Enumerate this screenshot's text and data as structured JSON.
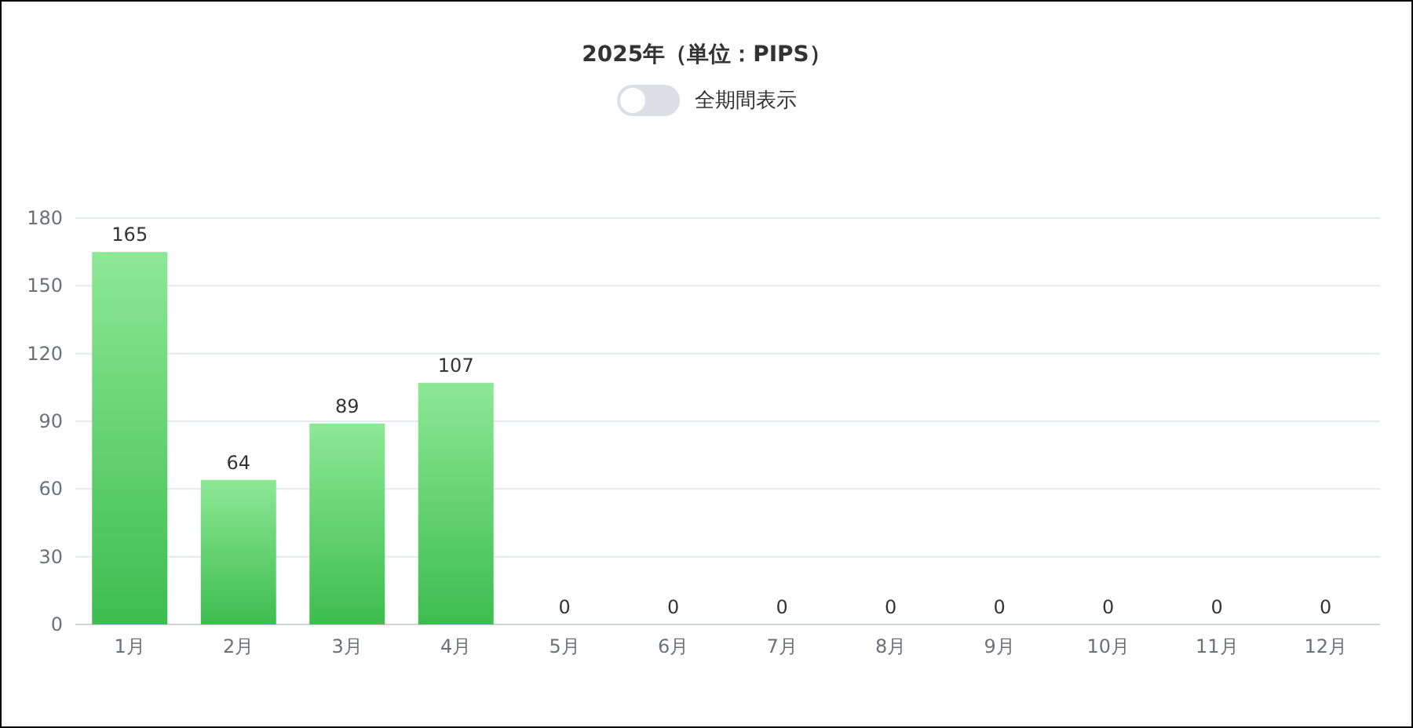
{
  "title": "2025年（単位：PIPS）",
  "toggle": {
    "label": "全期間表示",
    "on": false
  },
  "chart_data": {
    "type": "bar",
    "categories": [
      "1月",
      "2月",
      "3月",
      "4月",
      "5月",
      "6月",
      "7月",
      "8月",
      "9月",
      "10月",
      "11月",
      "12月"
    ],
    "values": [
      165,
      64,
      89,
      107,
      0,
      0,
      0,
      0,
      0,
      0,
      0,
      0
    ],
    "ylim": [
      0,
      180
    ],
    "yticks": [
      0,
      30,
      60,
      90,
      120,
      150,
      180
    ],
    "data_labels": true,
    "grid": true
  }
}
